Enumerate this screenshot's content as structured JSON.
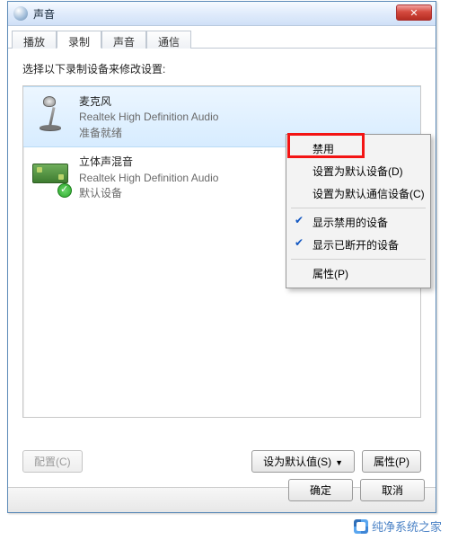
{
  "window": {
    "title": "声音",
    "close_glyph": "✕"
  },
  "tabs": [
    {
      "label": "播放"
    },
    {
      "label": "录制"
    },
    {
      "label": "声音"
    },
    {
      "label": "通信"
    }
  ],
  "active_tab_index": 1,
  "instruction": "选择以下录制设备来修改设置:",
  "devices": [
    {
      "name": "麦克风",
      "driver": "Realtek High Definition Audio",
      "status": "准备就绪",
      "selected": true
    },
    {
      "name": "立体声混音",
      "driver": "Realtek High Definition Audio",
      "status": "默认设备",
      "selected": false
    }
  ],
  "context_menu": {
    "items": [
      {
        "label": "禁用",
        "highlight": true
      },
      {
        "label": "设置为默认设备(D)"
      },
      {
        "label": "设置为默认通信设备(C)"
      },
      {
        "sep": true
      },
      {
        "label": "显示禁用的设备",
        "checked": true
      },
      {
        "label": "显示已断开的设备",
        "checked": true
      },
      {
        "sep": true
      },
      {
        "label": "属性(P)"
      }
    ]
  },
  "buttons": {
    "configure": "配置(C)",
    "set_default": "设为默认值(S)",
    "properties": "属性(P)",
    "ok": "确定",
    "cancel": "取消"
  },
  "watermark": "纯净系统之家"
}
